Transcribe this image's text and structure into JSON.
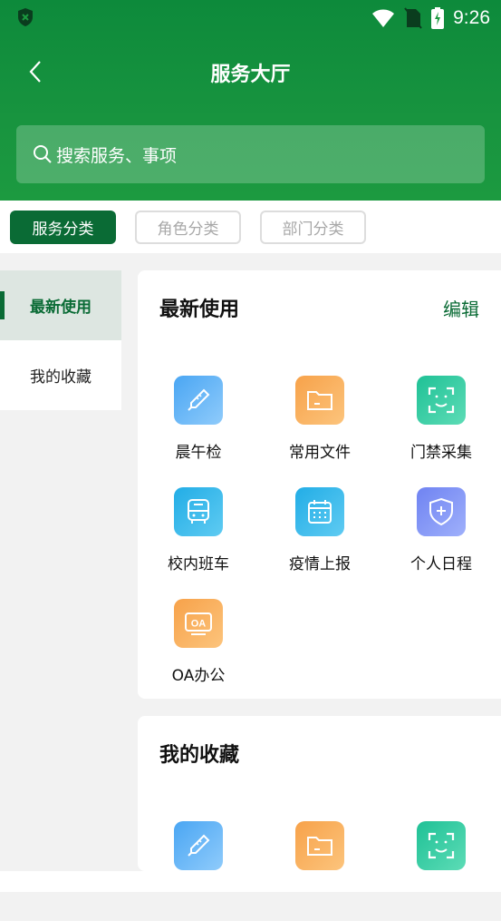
{
  "status_bar": {
    "time": "9:26"
  },
  "header": {
    "title": "服务大厅"
  },
  "search": {
    "placeholder": "搜索服务、事项"
  },
  "tabs": [
    {
      "label": "服务分类",
      "active": true
    },
    {
      "label": "角色分类",
      "active": false
    },
    {
      "label": "部门分类",
      "active": false
    }
  ],
  "sidebar": {
    "items": [
      {
        "label": "最新使用",
        "active": true
      },
      {
        "label": "我的收藏",
        "active": false
      }
    ]
  },
  "recent": {
    "title": "最新使用",
    "edit_label": "编辑",
    "apps": [
      {
        "label": "晨午检",
        "icon": "thermometer-icon",
        "color": "#5aaef5"
      },
      {
        "label": "常用文件",
        "icon": "folder-icon",
        "color": "#f9ac55"
      },
      {
        "label": "门禁采集",
        "icon": "face-scan-icon",
        "color": "#2ec9a0"
      },
      {
        "label": "校内班车",
        "icon": "bus-icon",
        "color": "#34b4e8"
      },
      {
        "label": "疫情上报",
        "icon": "calendar-icon",
        "color": "#33b6e6"
      },
      {
        "label": "个人日程",
        "icon": "shield-plus-icon",
        "color": "#7b8ef4"
      },
      {
        "label": "OA办公",
        "icon": "oa-icon",
        "color": "#f9ac55"
      }
    ]
  },
  "favorites": {
    "title": "我的收藏",
    "apps": [
      {
        "icon": "thermometer-icon",
        "color": "#5aaef5"
      },
      {
        "icon": "folder-icon",
        "color": "#f9ac55"
      },
      {
        "icon": "face-scan-icon",
        "color": "#2ec9a0"
      }
    ]
  }
}
